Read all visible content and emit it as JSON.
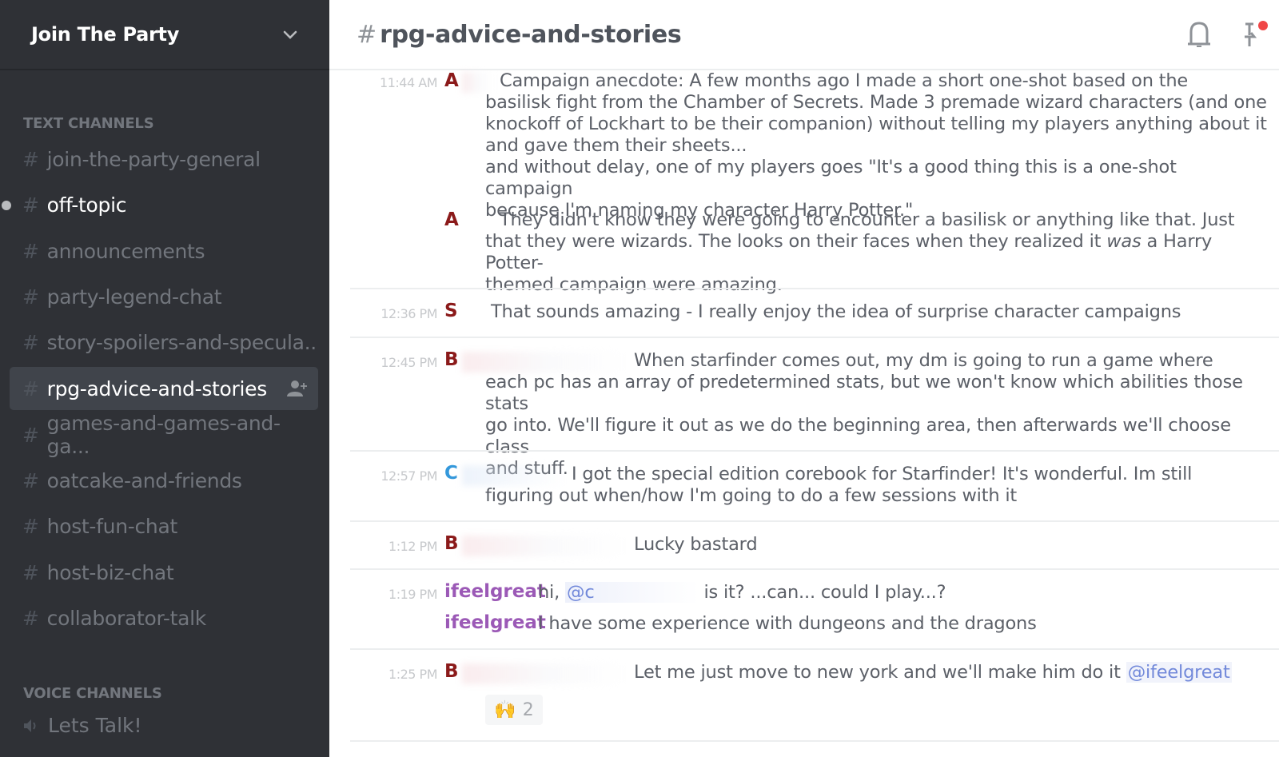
{
  "server": {
    "name": "Join The Party"
  },
  "sidebar": {
    "text_category": "TEXT CHANNELS",
    "voice_category": "VOICE CHANNELS",
    "channels": [
      {
        "name": "join-the-party-general",
        "state": "normal"
      },
      {
        "name": "off-topic",
        "state": "unread"
      },
      {
        "name": "announcements",
        "state": "normal"
      },
      {
        "name": "party-legend-chat",
        "state": "normal"
      },
      {
        "name": "story-spoilers-and-specula..",
        "state": "normal"
      },
      {
        "name": "rpg-advice-and-stories",
        "state": "active"
      },
      {
        "name": "games-and-games-and-ga...",
        "state": "normal"
      },
      {
        "name": "oatcake-and-friends",
        "state": "normal"
      },
      {
        "name": "host-fun-chat",
        "state": "normal"
      },
      {
        "name": "host-biz-chat",
        "state": "normal"
      },
      {
        "name": "collaborator-talk",
        "state": "normal"
      }
    ],
    "voice_channels": [
      {
        "name": "Lets Talk!"
      }
    ]
  },
  "header": {
    "hash": "#",
    "channel": "rpg-advice-and-stories",
    "notification_badge_color": "#f04747"
  },
  "messages": [
    {
      "time": "11:44 AM",
      "author_initial": "A",
      "author_color": "#8b1a1a",
      "lines": [
        "Campaign anecdote: A few months ago I made a short one-shot based on the",
        "basilisk fight from the Chamber of Secrets. Made 3 premade wizard characters (and one",
        "knockoff of Lockhart to be their companion) without telling my players anything about it",
        "and gave them their sheets...",
        "and without delay, one of my players goes \"It's a good thing this is a one-shot campaign",
        "because I'm naming my character Harry Potter.\""
      ],
      "followup": {
        "author_initial": "A",
        "line1": "They didn't know they were going to encounter a basilisk or anything like that. Just",
        "line2_before": "that they were wizards. The looks on their faces when they realized it ",
        "line2_italic": "was",
        "line2_after": " a Harry Potter-",
        "line3": "themed campaign were amazing."
      }
    },
    {
      "time": "12:36 PM",
      "author_initial": "S",
      "author_color": "#8b1a1a",
      "lines": [
        "That sounds amazing - I really enjoy the idea of surprise character campaigns"
      ]
    },
    {
      "time": "12:45 PM",
      "author_initial": "B",
      "author_color": "#8b1a1a",
      "lines": [
        "When starfinder comes out, my dm is going to run a game where",
        "each pc has an array of predetermined stats, but we won't know which abilities those stats",
        "go into. We'll figure it out as we do the beginning area, then afterwards we'll choose class",
        "and stuff."
      ]
    },
    {
      "time": "12:57 PM",
      "author_initial": "C",
      "author_color": "#3498db",
      "lines": [
        "I got the special edition corebook for Starfinder! It's wonderful. Im still",
        "figuring out when/how I'm going to do a few sessions with it"
      ]
    },
    {
      "time": "1:12 PM",
      "author_initial": "B",
      "author_color": "#8b1a1a",
      "lines": [
        "Lucky bastard"
      ]
    },
    {
      "time": "1:19 PM",
      "author": "ifeelgreat",
      "author_color": "#9b59b6",
      "line1_before": "hi, ",
      "mention": "@c",
      "line1_after": "is it? ...can... could I play...?",
      "line2_author": "ifeelgreat",
      "line2": "I have some experience with dungeons and the dragons"
    },
    {
      "time": "1:25 PM",
      "author_initial": "B",
      "author_color": "#8b1a1a",
      "text": "Let me just move to new york and we'll make him do it ",
      "mention": "@ifeelgreat",
      "reaction": {
        "emoji": "🙌",
        "count": "2"
      }
    }
  ]
}
